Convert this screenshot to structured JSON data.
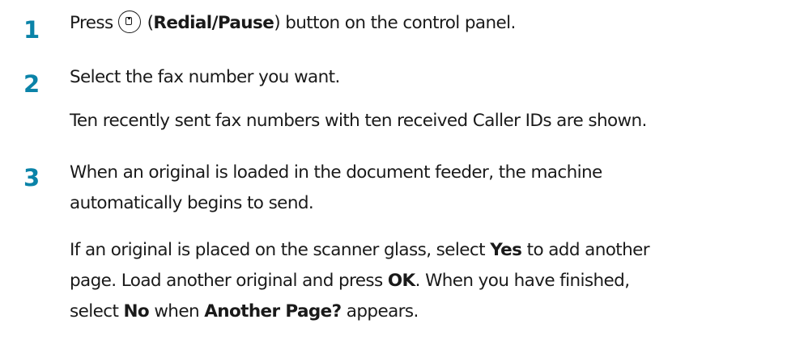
{
  "steps": [
    {
      "number": "1",
      "lines": [
        {
          "press": "Press",
          "open_paren": "(",
          "button": "Redial/Pause",
          "close_paren": ")",
          "rest": " button on the control panel."
        }
      ]
    },
    {
      "number": "2",
      "instruction": "Select the fax number you want.",
      "note": "Ten recently sent fax numbers with ten received Caller IDs are shown."
    },
    {
      "number": "3",
      "instruction_line1": "When an original is loaded in the document feeder, the machine",
      "instruction_line2": "automatically begins to send.",
      "glass_line1_pre": "If an original is placed on the scanner glass, select ",
      "glass_line1_yes": "Yes",
      "glass_line1_post": " to add another",
      "glass_line2_pre": "page. Load another original and press ",
      "glass_line2_ok": "OK",
      "glass_line2_post": ". When you have finished,",
      "glass_line3_pre": "select ",
      "glass_line3_no": "No",
      "glass_line3_mid": " when ",
      "glass_line3_prompt": "Another Page?",
      "glass_line3_post": " appears."
    }
  ],
  "icons": {
    "redial": "redial-pause-icon"
  },
  "colors": {
    "step_number": "#0a83a8",
    "text": "#1a1a1a"
  }
}
